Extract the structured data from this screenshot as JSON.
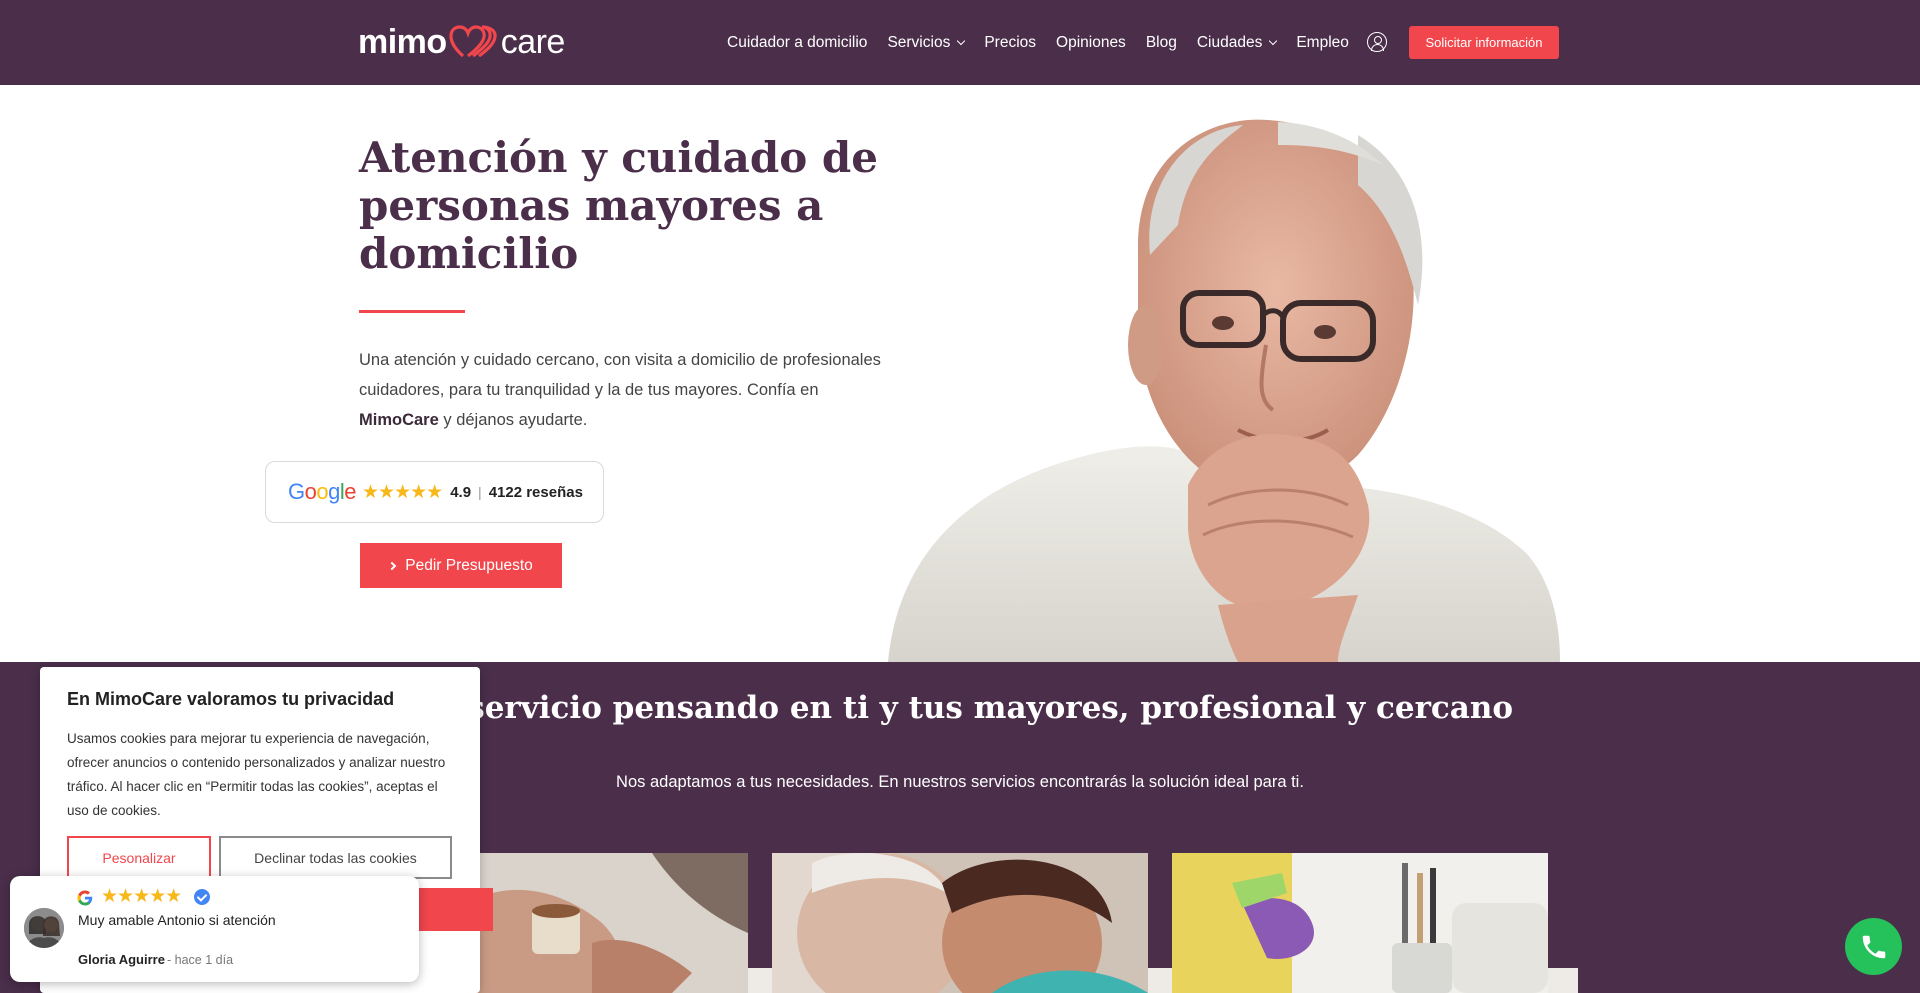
{
  "brand": {
    "logo_left": "mimo",
    "logo_right": "care"
  },
  "nav": {
    "items": [
      {
        "label": "Cuidador a domicilio",
        "has_dropdown": false
      },
      {
        "label": "Servicios",
        "has_dropdown": true
      },
      {
        "label": "Precios",
        "has_dropdown": false
      },
      {
        "label": "Opiniones",
        "has_dropdown": false
      },
      {
        "label": "Blog",
        "has_dropdown": false
      },
      {
        "label": "Ciudades",
        "has_dropdown": true
      },
      {
        "label": "Empleo",
        "has_dropdown": false
      }
    ],
    "account_icon": "user-circle-icon",
    "cta_label": "Solicitar información"
  },
  "hero": {
    "title": "Atención y cuidado de personas mayores a domicilio",
    "text_before": "Una atención y cuidado cercano, con visita a domicilio de profesionales cuidadores, para tu tranquilidad y la de tus mayores. Confía en ",
    "text_brand": "MimoCare",
    "text_after": " y déjanos ayudarte.",
    "rating": {
      "provider": "Google",
      "stars": 5,
      "score": "4.9",
      "separator": "|",
      "count": "4122 reseñas"
    },
    "button_label": "Pedir Presupuesto"
  },
  "services": {
    "title": "Un servicio pensando en ti y tus mayores, profesional y cercano",
    "subtitle": "Nos adaptamos a tus necesidades. En nuestros servicios encontrarás la solución ideal para ti."
  },
  "cookie": {
    "title": "En MimoCare valoramos tu privacidad",
    "text": "Usamos cookies para mejorar tu experiencia de navegación, ofrecer anuncios o contenido personalizados y analizar nuestro tráfico. Al hacer clic en “Permitir todas las cookies”, aceptas el uso de cookies.",
    "personalize_label": "Pesonalizar",
    "decline_label": "Declinar todas las cookies"
  },
  "review": {
    "stars": 5,
    "text": "Muy amable Antonio si atención",
    "author": "Gloria Aguirre",
    "time": "- hace 1 día"
  },
  "colors": {
    "brand_purple": "#4a2e4a",
    "accent_red": "#f0464c",
    "whatsapp_green": "#25c15a",
    "star_yellow": "#f6b81a"
  },
  "icons": {
    "phone": "phone-icon",
    "verified": "verified-check-icon",
    "google": "google-g-icon"
  }
}
